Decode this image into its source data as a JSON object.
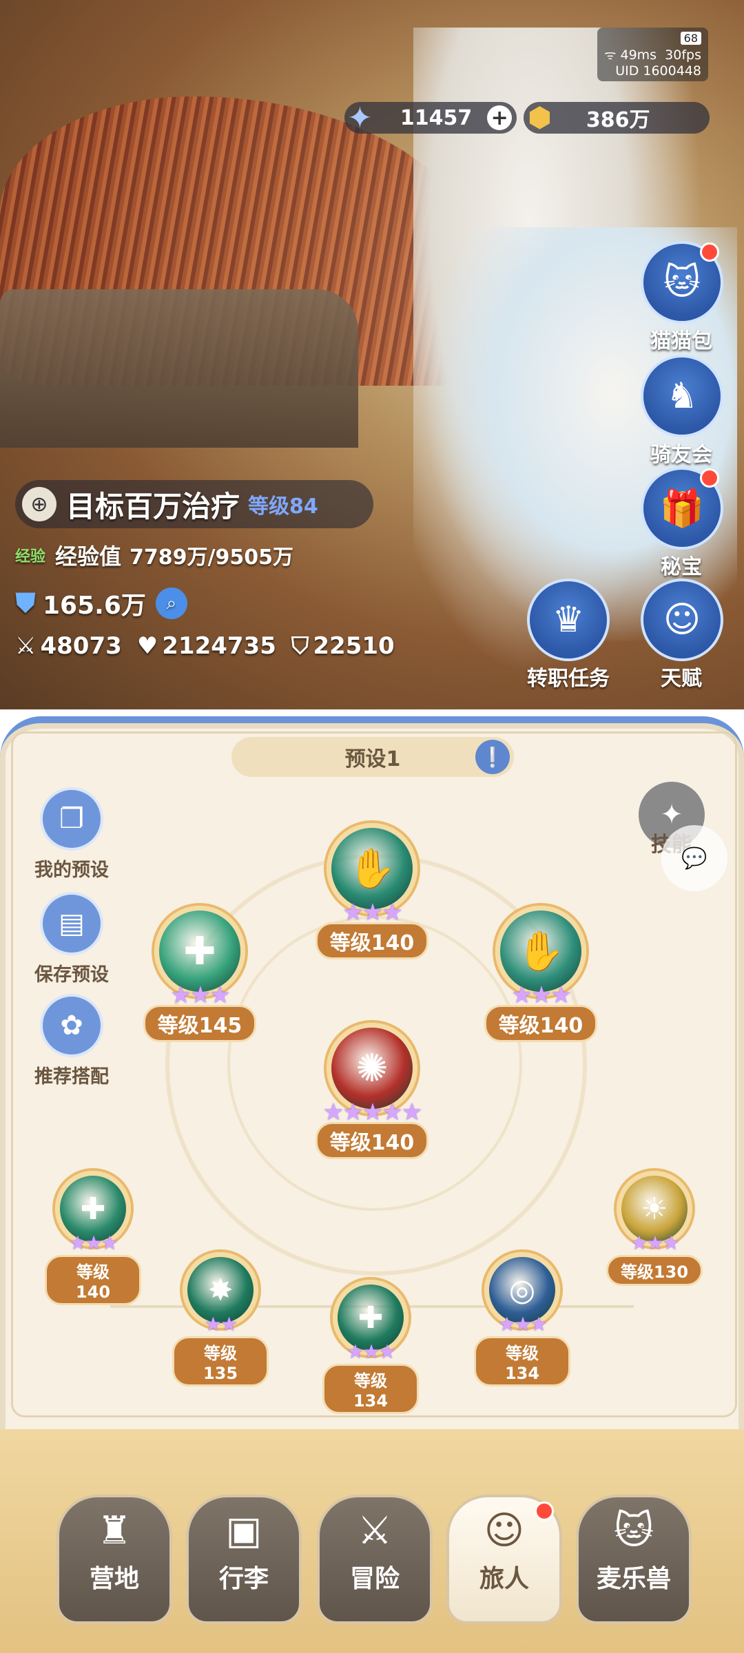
{
  "status": {
    "battery": "68",
    "ping": "49ms",
    "fps": "30fps",
    "uid": "UID 1600448"
  },
  "currency": {
    "star": "11457",
    "star_plus": "+",
    "coin": "386万"
  },
  "player": {
    "name": "目标百万治疗",
    "level": "等级84",
    "exp_tag": "经验",
    "exp_label": "经验值",
    "exp_value": "7789万/9505万",
    "power": "165.6万",
    "attack": "48073",
    "hp": "2124735",
    "defense": "22510"
  },
  "side_buttons": [
    {
      "label": "猫猫包",
      "icon": "cat-bag-icon",
      "badge": true
    },
    {
      "label": "骑友会",
      "icon": "horse-icon",
      "badge": false
    },
    {
      "label": "秘宝",
      "icon": "treasure-icon",
      "badge": true
    },
    {
      "label": "转职任务",
      "icon": "crown-icon",
      "badge": false
    },
    {
      "label": "天赋",
      "icon": "brain-icon",
      "badge": false
    }
  ],
  "panel": {
    "preset_title": "预设1",
    "skill_label": "技能",
    "left_buttons": [
      {
        "label": "我的预设",
        "icon": "preset-cards-icon"
      },
      {
        "label": "保存预设",
        "icon": "save-icon"
      },
      {
        "label": "推荐搭配",
        "icon": "recommend-icon"
      }
    ],
    "skills": [
      {
        "level": "等级140",
        "stars": "★★★",
        "color": "#2a8b72"
      },
      {
        "level": "等级145",
        "stars": "★★★",
        "color": "#37a37c"
      },
      {
        "level": "等级140",
        "stars": "★★★",
        "color": "#2f8f7a"
      },
      {
        "level": "等级140",
        "stars": "★★★★★",
        "color": "#b3302a"
      },
      {
        "level": "等级140",
        "stars": "★★★",
        "color": "#2a8a6a"
      },
      {
        "level": "等级135",
        "stars": "★★",
        "color": "#1f7b5e"
      },
      {
        "level": "等级134",
        "stars": "★★★",
        "color": "#1f7b5e"
      },
      {
        "level": "等级134",
        "stars": "★★★",
        "color": "#2e5e96"
      },
      {
        "level": "等级130",
        "stars": "★★★",
        "color": "#c9a43a"
      }
    ]
  },
  "tabs": [
    {
      "label": "营地",
      "icon": "castle-icon"
    },
    {
      "label": "行李",
      "icon": "backpack-icon"
    },
    {
      "label": "冒险",
      "icon": "swords-icon"
    },
    {
      "label": "旅人",
      "icon": "traveler-icon",
      "active": true
    },
    {
      "label": "麦乐兽",
      "icon": "pet-icon"
    }
  ]
}
